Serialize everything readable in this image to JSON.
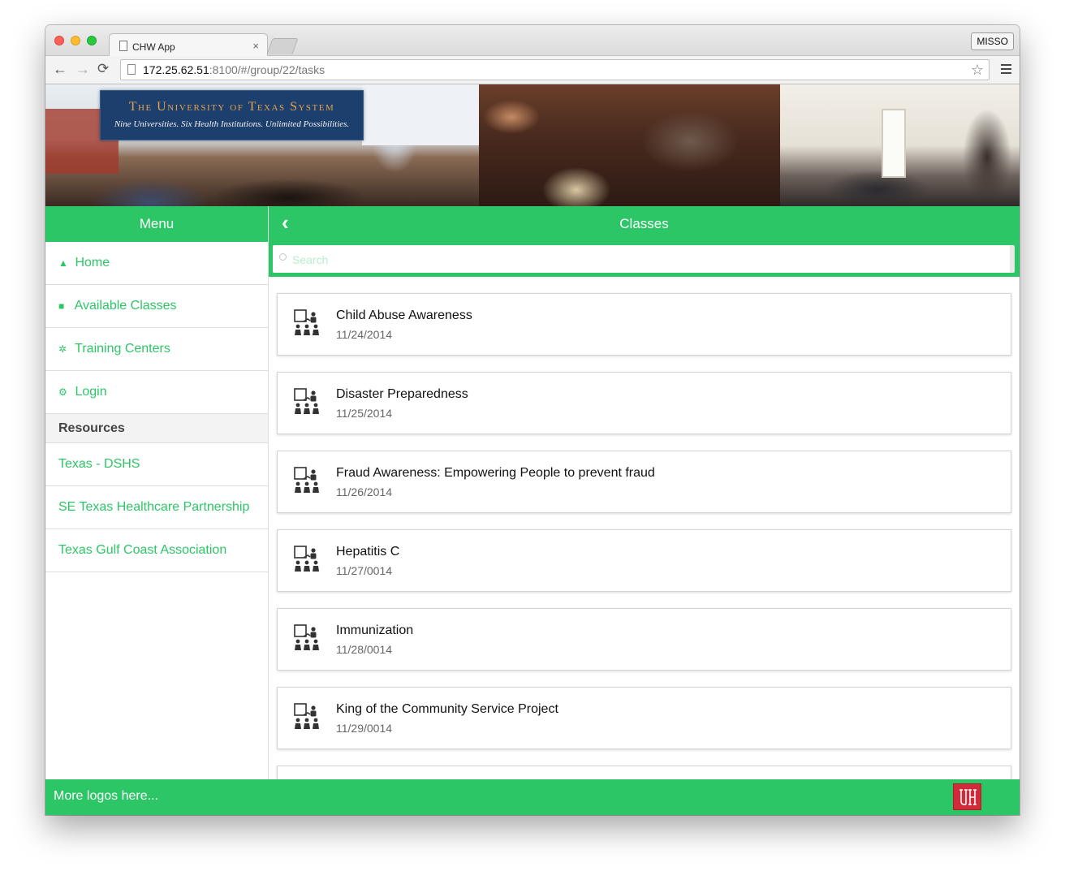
{
  "browser": {
    "tab_title": "CHW App",
    "tab_close": "×",
    "profile_button": "MISSO",
    "url_host": "172.25.62.51",
    "url_rest": ":8100/#/group/22/tasks",
    "back_icon": "←",
    "forward_icon": "→",
    "reload_icon": "⟳",
    "star_icon": "☆"
  },
  "banner": {
    "logo_title": "The University of Texas System",
    "logo_tagline": "Nine Universities. Six Health Institutions. Unlimited Possibilities."
  },
  "sidebar": {
    "title": "Menu",
    "items": [
      {
        "label": "Home",
        "icon": "home-icon",
        "glyph": "▲"
      },
      {
        "label": "Available Classes",
        "icon": "book-icon",
        "glyph": "■"
      },
      {
        "label": "Training Centers",
        "icon": "group-icon",
        "glyph": "✲"
      },
      {
        "label": "Login",
        "icon": "gear-icon",
        "glyph": "⚙"
      }
    ],
    "resources_heading": "Resources",
    "resources": [
      {
        "label": "Texas - DSHS"
      },
      {
        "label": "SE Texas Healthcare Partnership"
      },
      {
        "label": "Texas Gulf Coast Association"
      }
    ]
  },
  "main": {
    "title": "Classes",
    "back_icon": "‹",
    "search_placeholder": "Search",
    "classes": [
      {
        "title": "Child Abuse Awareness",
        "date": "11/24/2014"
      },
      {
        "title": "Disaster Preparedness",
        "date": "11/25/2014"
      },
      {
        "title": "Fraud Awareness: Empowering People to prevent fraud",
        "date": "11/26/2014"
      },
      {
        "title": "Hepatitis C",
        "date": "11/27/0014"
      },
      {
        "title": "Immunization",
        "date": "11/28/0014"
      },
      {
        "title": "King of the Community Service Project",
        "date": "11/29/0014"
      }
    ]
  },
  "footer": {
    "text": "More logos here..."
  },
  "colors": {
    "accent": "#2dc667",
    "uh_red": "#d32a3a",
    "ut_blue": "#1d3f6e"
  }
}
